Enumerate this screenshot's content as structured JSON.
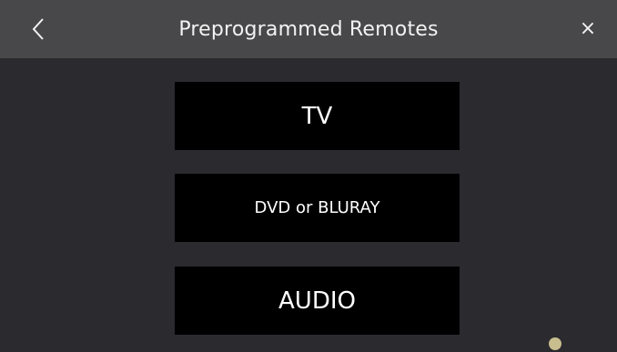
{
  "header": {
    "title": "Preprogrammed Remotes",
    "back_icon": "chevron-left-icon",
    "close_icon": "close-icon",
    "close_glyph": "×"
  },
  "remotes": [
    {
      "label": "TV"
    },
    {
      "label": "DVD or BLURAY"
    },
    {
      "label": "AUDIO"
    }
  ],
  "colors": {
    "background": "#2b2a2f",
    "header": "#48484a",
    "button": "#000000",
    "text": "#ffffff",
    "indicator": "#c8bd8e"
  }
}
